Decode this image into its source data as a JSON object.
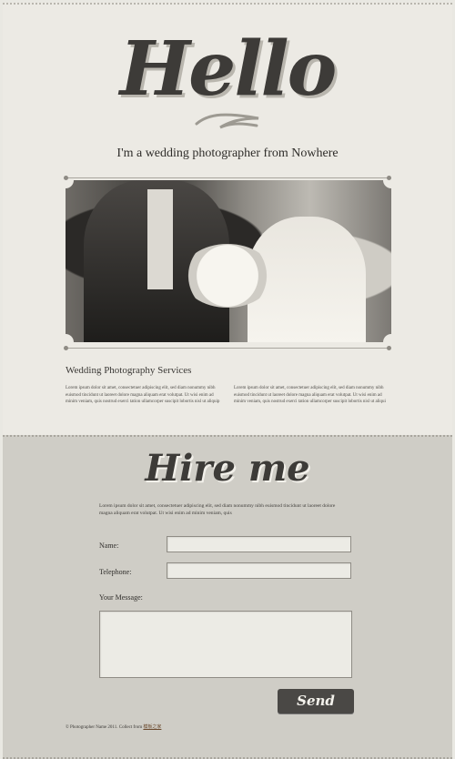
{
  "hero": {
    "title": "Hello",
    "tagline": "I'm a wedding photographer from Nowhere"
  },
  "photo": {
    "alt": "Wedding couple with bouquet"
  },
  "services": {
    "title": "Wedding Photography Services",
    "col1": "Lorem ipsum dolor sit amet, consectetuer adipiscing elit, sed diam nonummy nibh euismod tincidunt ut laoreet dolore magna aliquam erat volutpat. Ut wisi enim ad minim veniam, quis nostrud exerci tation ullamcorper suscipit lobortis nisl ut aliquip",
    "col2": "Lorem ipsum dolor sit amet, consectetuer adipiscing elit, sed diam nonummy nibh euismod tincidunt ut laoreet dolore magna aliquam erat volutpat. Ut wisi enim ad minim veniam, quis nostrud exerci tation ullamcorper suscipit lobortis nisl ut aliqui"
  },
  "hire": {
    "title": "Hire me",
    "intro": "Lorem ipsum dolor sit amet, consectetuer adipiscing elit, sed diam nonummy nibh euismod tincidunt ut laoreet dolore magna aliquam erat volutpat. Ut wisi enim ad minim veniam, quis"
  },
  "form": {
    "name_label": "Name:",
    "name_value": "",
    "telephone_label": "Telephone:",
    "telephone_value": "",
    "message_label": "Your Message:",
    "message_value": "",
    "send_label": "Send"
  },
  "footer": {
    "text": "© Photographer Name 2011. Collect from",
    "link_text": "模板之家"
  },
  "colors": {
    "paper": "#eceae4",
    "paper_dark": "#cfcdc6",
    "ink": "#3d3b38"
  }
}
